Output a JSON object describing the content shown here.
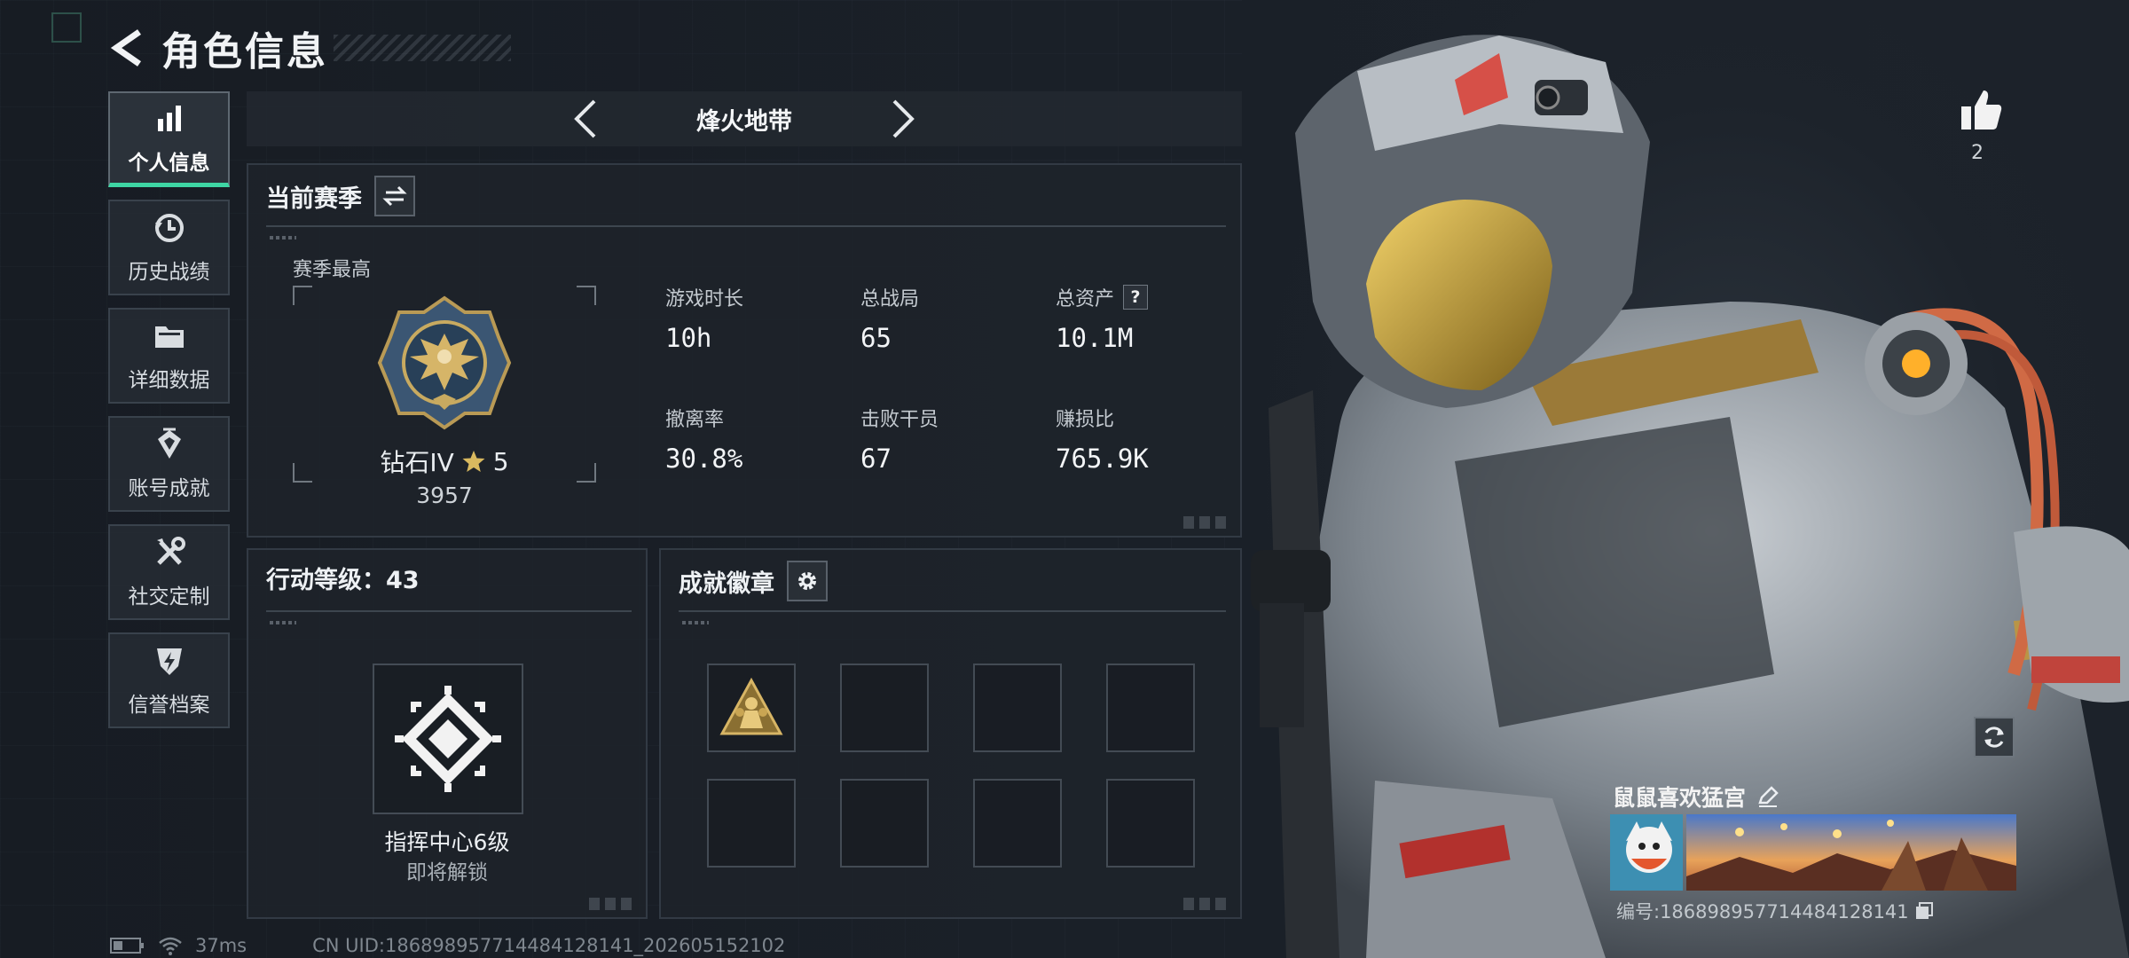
{
  "header": {
    "title": "角色信息"
  },
  "sidebar": {
    "items": [
      {
        "label": "个人信息",
        "icon": "bar-chart-icon",
        "active": true
      },
      {
        "label": "历史战绩",
        "icon": "history-clock-icon",
        "active": false
      },
      {
        "label": "详细数据",
        "icon": "folder-icon",
        "active": false
      },
      {
        "label": "账号成就",
        "icon": "achievement-icon",
        "active": false
      },
      {
        "label": "社交定制",
        "icon": "tools-icon",
        "active": false
      },
      {
        "label": "信誉档案",
        "icon": "shield-lightning-icon",
        "active": false
      }
    ]
  },
  "mode": {
    "title": "烽火地带"
  },
  "season": {
    "title": "当前赛季",
    "best_label": "赛季最高",
    "rank_name": "钻石IV",
    "rank_stars": "5",
    "rank_score": "3957",
    "stats": [
      {
        "label": "游戏时长",
        "value": "10h"
      },
      {
        "label": "总战局",
        "value": "65"
      },
      {
        "label": "总资产",
        "value": "10.1M",
        "help": "?"
      },
      {
        "label": "撤离率",
        "value": "30.8%"
      },
      {
        "label": "击败干员",
        "value": "67"
      },
      {
        "label": "赚损比",
        "value": "765.9K"
      }
    ]
  },
  "level": {
    "title": "行动等级：43",
    "cap_title": "指挥中心6级",
    "cap_sub": "即将解锁"
  },
  "badges": {
    "title": "成就徽章"
  },
  "profile": {
    "likes": "2",
    "player_name": "鼠鼠喜欢猛宫",
    "player_id": "编号:1868989577144841281​41"
  },
  "footer": {
    "ping": "37ms",
    "uid": "CN UID:1868989577144841281​41_202605152102"
  },
  "colors": {
    "accent": "#3ed6a4",
    "gold": "#c9a544"
  }
}
